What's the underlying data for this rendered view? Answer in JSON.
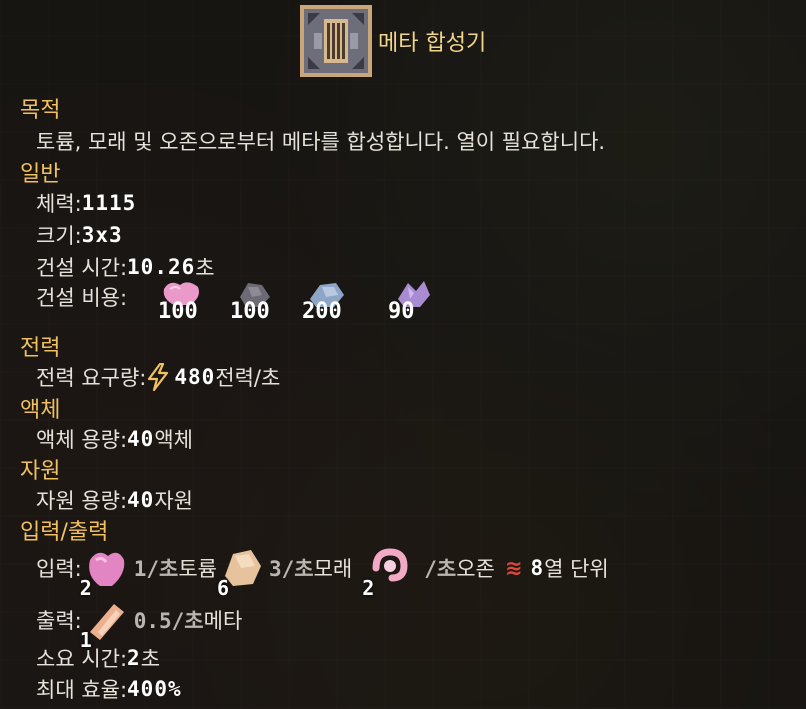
{
  "building": {
    "title": "메타 합성기",
    "icon": "meta-synthesizer-icon"
  },
  "sections": {
    "purpose": "목적",
    "general": "일반",
    "power": "전력",
    "fluid": "액체",
    "resource": "자원",
    "io": "입력/출력"
  },
  "purpose_text": "토륨, 모래 및 오존으로부터 메타를 합성합니다. 열이 필요합니다.",
  "general": {
    "health_label": "체력: ",
    "health_value": "1115",
    "size_label": "크기: ",
    "size_value": "3x3",
    "build_time_label": "건설 시간: ",
    "build_time_value": "10.26",
    "build_time_unit": " 초",
    "build_cost_label": "건설 비용: ",
    "build_cost": [
      {
        "icon": "pink-crystal-icon",
        "amount": "100",
        "color": "#e99ac8"
      },
      {
        "icon": "dark-ore-icon",
        "amount": "100",
        "color": "#6b6a75"
      },
      {
        "icon": "blue-ore-icon",
        "amount": "200",
        "color": "#8da6c7"
      },
      {
        "icon": "purple-crystal-icon",
        "amount": "90",
        "color": "#a98bd1"
      }
    ]
  },
  "power": {
    "label": "전력 요구량: ",
    "icon": "lightning-icon",
    "value": "480",
    "unit": " 전력/초"
  },
  "fluid": {
    "label": "액체 용량: ",
    "value": "40",
    "unit": " 액체"
  },
  "resource": {
    "label": "자원 용량: ",
    "value": "40",
    "unit": " 자원"
  },
  "io": {
    "input_label": "입력: ",
    "inputs": [
      {
        "icon": "thorium-icon",
        "count": "2",
        "rate": "1/초",
        "name": " 토륨 "
      },
      {
        "icon": "sand-icon",
        "count": "6",
        "rate": "3/초",
        "name": " 모래 "
      },
      {
        "icon": "ozone-icon",
        "count": "2",
        "rate": "/초",
        "name": " 오존"
      }
    ],
    "heat_icon": "heat-icon",
    "heat_value": "8",
    "heat_unit": " 열 단위",
    "output_label": "출력: ",
    "output": {
      "icon": "meta-icon",
      "count": "1",
      "rate": "0.5/초",
      "name": " 메타"
    },
    "craft_time_label": "소요 시간: ",
    "craft_time_value": "2",
    "craft_time_unit": " 초",
    "max_eff_label": "최대 효율: ",
    "max_eff_value": "400%"
  }
}
